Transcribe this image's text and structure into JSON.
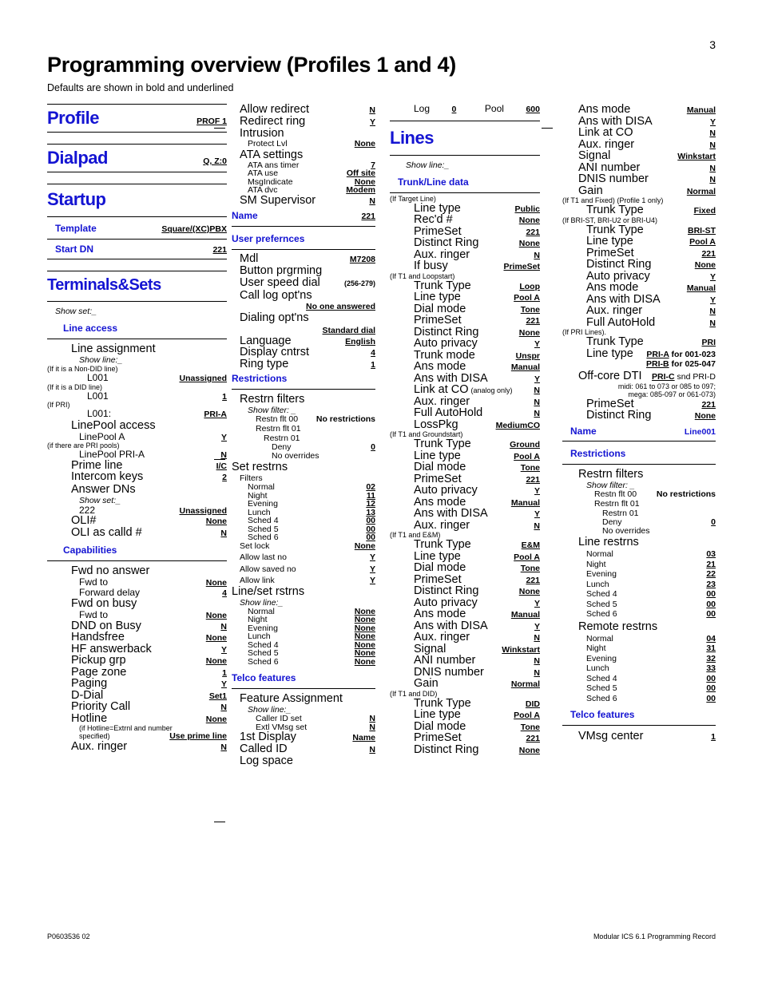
{
  "page": {
    "number": "3",
    "title": "Programming overview (Profiles 1 and 4)",
    "subtitle": "Defaults are shown in bold and underlined",
    "footer_left": "P0603536   02",
    "footer_right": "Modular ICS 6.1 Programming Record",
    "accent_color": "#1414d2"
  },
  "col1": {
    "profile": {
      "heading": "Profile",
      "value": "PROF 1"
    },
    "dialpad": {
      "heading": "Dialpad",
      "value": "Q, Z:0"
    },
    "startup": {
      "heading": "Startup",
      "rows": [
        {
          "label": "Template",
          "value": "Square/(XC)PBX"
        },
        {
          "label": "Start DN",
          "value": "221"
        }
      ]
    },
    "terminals": {
      "heading": "Terminals&Sets",
      "show_set": "Show set:_",
      "line_access": {
        "heading": "Line access",
        "line_assignment": "Line assignment",
        "show_line": "Show line:_",
        "cond_nondid": "(If it is a Non-DID line)",
        "l001_nondid": {
          "label": "L001",
          "value": "Unassigned"
        },
        "cond_did": "(If it is a DID line)",
        "l001_did": {
          "label": "L001",
          "value": "1"
        },
        "cond_pri": "(If PRI)",
        "l001_pri": {
          "label": "L001:",
          "value": "PRI-A"
        },
        "linepool_access": "LinePool access",
        "linepool_a": {
          "label": "LinePool  A",
          "value": "Y"
        },
        "cond_pripools": "(if there are PRI pools)",
        "linepool_pri_a": {
          "label": "LinePool PRI-A",
          "value": "N"
        },
        "rows": [
          {
            "label": "Prime line",
            "value": "I/C"
          },
          {
            "label": "Intercom keys",
            "value": "2"
          }
        ],
        "answer_dns": "Answer DNs",
        "show_set2": "Show set:_",
        "dn222": {
          "label": "222",
          "value": "Unassigned"
        },
        "rows2": [
          {
            "label": "OLI#",
            "value": "None"
          },
          {
            "label": "OLI as calld #",
            "value": "N"
          }
        ]
      },
      "capabilities": {
        "heading": "Capabilities",
        "fwd_no_answer": "Fwd no answer",
        "fwd_no_answer_rows": [
          {
            "label": "Fwd to",
            "value": "None"
          },
          {
            "label": "Forward delay",
            "value": "4"
          }
        ],
        "fwd_on_busy": "Fwd on busy",
        "fwd_on_busy_rows": [
          {
            "label": "Fwd to",
            "value": "None"
          }
        ],
        "rows": [
          {
            "label": "DND on Busy",
            "value": "N"
          },
          {
            "label": "Handsfree",
            "value": "None"
          },
          {
            "label": "HF answerback",
            "value": "Y"
          },
          {
            "label": "Pickup grp",
            "value": "None"
          },
          {
            "label": "Page zone",
            "value": "1"
          },
          {
            "label": "Paging",
            "value": "Y"
          },
          {
            "label": "D-Dial",
            "value": "Set1"
          },
          {
            "label": "Priority Call",
            "value": "N"
          },
          {
            "label": "Hotline",
            "value": "None"
          }
        ],
        "hotline_cond1": "(if Hotline=Extrnl and number",
        "hotline_cond2": "specified)",
        "hotline_cond_value": "Use prime line",
        "aux_ringer": {
          "label": "Aux. ringer",
          "value": "N"
        }
      }
    }
  },
  "col2": {
    "top_rows": [
      {
        "label": "Allow redirect",
        "value": "N",
        "size": "big",
        "indent": 1
      },
      {
        "label": "Redirect ring",
        "value": "Y",
        "size": "big",
        "indent": 1
      },
      {
        "label": "Intrusion",
        "value": "",
        "size": "big",
        "indent": 1
      },
      {
        "label": "Protect Lvl",
        "value": "None",
        "size": "sm",
        "indent": 2
      },
      {
        "label": "ATA settings",
        "value": "",
        "size": "big",
        "indent": 1
      },
      {
        "label": "ATA ans timer",
        "value": "7",
        "size": "sm",
        "indent": 2
      },
      {
        "label": "ATA use",
        "value": "Off site",
        "size": "sm",
        "indent": 2
      },
      {
        "label": "MsgIndicate",
        "value": "None",
        "size": "sm",
        "indent": 2
      },
      {
        "label": "ATA dvc",
        "value": "Modem",
        "size": "sm",
        "indent": 2
      },
      {
        "label": "SM Supervisor",
        "value": "N",
        "size": "big",
        "indent": 1
      }
    ],
    "name": {
      "heading": "Name",
      "value": "221"
    },
    "user_prefs": {
      "heading": "User prefernces",
      "rows": [
        {
          "label": "Mdl",
          "value": "M7208"
        },
        {
          "label": "Button prgrming",
          "value": ""
        },
        {
          "label": "User speed dial",
          "value": "(256-279)"
        },
        {
          "label": "Call log opt'ns",
          "value": ""
        }
      ],
      "call_log_value": "No one answered",
      "dialing_optns": "Dialing opt'ns",
      "dialing_value": "Standard dial",
      "rows2": [
        {
          "label": "Language",
          "value": "English"
        },
        {
          "label": "Display cntrst",
          "value": "4"
        },
        {
          "label": "Ring type",
          "value": "1"
        }
      ]
    },
    "restrictions": {
      "heading": "Restrictions",
      "restrn_filters": "Restrn filters",
      "show_filter": "Show filter: _",
      "flt00": {
        "label": "Restn flt 00",
        "value": "No restrictions"
      },
      "flt01": "Restrn flt 01",
      "restrn01": "Restrn 01",
      "deny": {
        "label": "Deny",
        "value": "0"
      },
      "no_overrides": "No overrides",
      "set_restrns": "Set restrns",
      "filters": "Filters",
      "filter_rows": [
        {
          "label": "Normal",
          "value": "02"
        },
        {
          "label": "Night",
          "value": "11"
        },
        {
          "label": "Evening",
          "value": "12"
        },
        {
          "label": "Lunch",
          "value": "13"
        },
        {
          "label": "Sched 4",
          "value": "00"
        },
        {
          "label": "Sched 5",
          "value": "00"
        },
        {
          "label": "Sched 6",
          "value": "00"
        }
      ],
      "set_lock": {
        "label": "Set lock",
        "value": "None"
      },
      "allow_rows": [
        {
          "label": "Allow last no",
          "value": "Y"
        },
        {
          "label": "Allow saved no",
          "value": "Y"
        },
        {
          "label": "Allow link",
          "value": "Y"
        }
      ],
      "line_set_rstrns": "Line/set rstrns",
      "show_line": "Show line:_",
      "line_rows": [
        {
          "label": "Normal",
          "value": "None"
        },
        {
          "label": "Night",
          "value": "None"
        },
        {
          "label": "Evening",
          "value": "None"
        },
        {
          "label": "Lunch",
          "value": "None"
        },
        {
          "label": "Sched 4",
          "value": "None"
        },
        {
          "label": "Sched 5",
          "value": "None"
        },
        {
          "label": "Sched 6",
          "value": "None"
        }
      ]
    },
    "telco": {
      "heading": "Telco features",
      "feature_assignment": "Feature Assignment",
      "show_line": "Show line:_",
      "rows_sm": [
        {
          "label": "Caller ID set",
          "value": "N"
        },
        {
          "label": "Extl VMsg set",
          "value": "N"
        }
      ],
      "rows_big": [
        {
          "label": "1st Display",
          "value": "Name"
        },
        {
          "label": "Called ID",
          "value": "N"
        },
        {
          "label": "Log space",
          "value": ""
        }
      ]
    }
  },
  "col3": {
    "log_pool": {
      "log_label": "Log",
      "log_value": "0",
      "pool_label": "Pool",
      "pool_value": "600"
    },
    "lines_heading": "Lines",
    "show_line": "Show line:_",
    "trunk_line_data": "Trunk/Line data",
    "cond_target": "(If Target Line)",
    "target_rows": [
      {
        "label": "Line type",
        "value": "Public"
      },
      {
        "label": "Rec'd #",
        "value": "None"
      },
      {
        "label": "PrimeSet",
        "value": "221"
      },
      {
        "label": "Distinct Ring",
        "value": "None"
      },
      {
        "label": "Aux. ringer",
        "value": "N"
      },
      {
        "label": "If busy",
        "value": "PrimeSet"
      }
    ],
    "cond_loopstart": "(If T1 and Loopstart)",
    "loop_rows": [
      {
        "label": "Trunk Type",
        "value": "Loop"
      },
      {
        "label": "Line type",
        "value": "Pool A"
      },
      {
        "label": "Dial mode",
        "value": "Tone"
      },
      {
        "label": "PrimeSet",
        "value": "221"
      },
      {
        "label": "Distinct Ring",
        "value": "None"
      },
      {
        "label": "Auto privacy",
        "value": "Y"
      },
      {
        "label": "Trunk mode",
        "value": "Unspr"
      },
      {
        "label": "Ans mode",
        "value": "Manual"
      },
      {
        "label": "Ans with DISA",
        "value": "Y"
      }
    ],
    "link_at_co": {
      "label": "Link at CO",
      "note": "(analog only)",
      "value": "N"
    },
    "loop_rows2": [
      {
        "label": "Aux. ringer",
        "value": "N"
      },
      {
        "label": "Full AutoHold",
        "value": "N"
      },
      {
        "label": "LossPkg",
        "value": "MediumCO"
      }
    ],
    "cond_groundstart": "(If T1 and Groundstart)",
    "ground_rows": [
      {
        "label": "Trunk Type",
        "value": "Ground"
      },
      {
        "label": "Line type",
        "value": "Pool A"
      },
      {
        "label": "Dial mode",
        "value": "Tone"
      },
      {
        "label": "PrimeSet",
        "value": "221"
      },
      {
        "label": "Auto privacy",
        "value": "Y"
      },
      {
        "label": "Ans mode",
        "value": "Manual"
      },
      {
        "label": "Ans with DISA",
        "value": "Y"
      },
      {
        "label": "Aux. ringer",
        "value": "N"
      }
    ],
    "cond_em": "(If T1 and E&M)",
    "em_rows": [
      {
        "label": "Trunk Type",
        "value": "E&M"
      },
      {
        "label": "Line type",
        "value": "Pool A"
      },
      {
        "label": "Dial mode",
        "value": "Tone"
      },
      {
        "label": "PrimeSet",
        "value": "221"
      },
      {
        "label": "Distinct Ring",
        "value": "None"
      },
      {
        "label": "Auto privacy",
        "value": "Y"
      },
      {
        "label": "Ans mode",
        "value": "Manual"
      },
      {
        "label": "Ans with DISA",
        "value": "Y"
      },
      {
        "label": "Aux. ringer",
        "value": "N"
      },
      {
        "label": "Signal",
        "value": "Winkstart"
      },
      {
        "label": "ANI number",
        "value": "N"
      },
      {
        "label": "DNIS number",
        "value": "N"
      },
      {
        "label": "Gain",
        "value": "Normal"
      }
    ],
    "cond_did": "(If T1 and DID)",
    "did_rows": [
      {
        "label": "Trunk Type",
        "value": "DID"
      },
      {
        "label": "Line type",
        "value": "Pool A"
      },
      {
        "label": "Dial mode",
        "value": "Tone"
      },
      {
        "label": "PrimeSet",
        "value": "221"
      },
      {
        "label": "Distinct Ring",
        "value": "None"
      }
    ]
  },
  "col4": {
    "top_rows": [
      {
        "label": "Ans mode",
        "value": "Manual"
      },
      {
        "label": "Ans with DISA",
        "value": "Y"
      },
      {
        "label": "Link at CO",
        "value": "N"
      },
      {
        "label": "Aux. ringer",
        "value": "N"
      },
      {
        "label": "Signal",
        "value": "Winkstart"
      },
      {
        "label": "ANI number",
        "value": "N"
      },
      {
        "label": "DNIS number",
        "value": "N"
      },
      {
        "label": "Gain",
        "value": "Normal"
      }
    ],
    "cond_fixed": "(If T1 and Fixed) (Profile 1 only)",
    "fixed_row": {
      "label": "Trunk Type",
      "value": "Fixed"
    },
    "cond_bri": "(If BRI-ST, BRI-U2 or BRI-U4)",
    "bri_rows": [
      {
        "label": "Trunk Type",
        "value": "BRI-ST"
      },
      {
        "label": "Line type",
        "value": "Pool A"
      },
      {
        "label": "PrimeSet",
        "value": "221"
      },
      {
        "label": "Distinct Ring",
        "value": "None"
      },
      {
        "label": "Auto privacy",
        "value": "Y"
      },
      {
        "label": "Ans mode",
        "value": "Manual"
      },
      {
        "label": "Ans with DISA",
        "value": "Y"
      },
      {
        "label": "Aux. ringer",
        "value": "N"
      },
      {
        "label": "Full AutoHold",
        "value": "N"
      }
    ],
    "cond_pri": "(If PRI Lines).",
    "pri_trunk": {
      "label": "Trunk Type",
      "value": "PRI"
    },
    "pri_linetype_label": "Line type",
    "pri_linetype_v1_bold": "PRI-A",
    "pri_linetype_v1_rest": " for 001-023",
    "pri_linetype_v2_bold": "PRI-B",
    "pri_linetype_v2_rest": " for 025-047",
    "offcore_label": "Off-core DTI",
    "offcore_bold": "PRI-C",
    "offcore_rest": " snd PRI-D",
    "offcore_note1": "midi: 061 to 073 or 085 to 097;",
    "offcore_note2": "mega: 085-097 or 061-073)",
    "pri_rows2": [
      {
        "label": "PrimeSet",
        "value": "221"
      },
      {
        "label": "Distinct Ring",
        "value": "None"
      }
    ],
    "name": {
      "heading": "Name",
      "value": "Line001"
    },
    "restrictions": {
      "heading": "Restrictions",
      "restrn_filters": "Restrn filters",
      "show_filter": "Show filter: _",
      "flt00": {
        "label": "Restn flt 00",
        "value": "No restrictions"
      },
      "flt01": "Restrn flt 01",
      "restrn01": "Restrn 01",
      "deny": {
        "label": "Deny",
        "value": "0"
      },
      "no_overrides": "No overrides",
      "line_restrns": "Line restrns",
      "line_rows": [
        {
          "label": "Normal",
          "value": "03"
        },
        {
          "label": "Night",
          "value": "21"
        },
        {
          "label": "Evening",
          "value": "22"
        },
        {
          "label": "Lunch",
          "value": "23"
        },
        {
          "label": "Sched 4",
          "value": "00"
        },
        {
          "label": "Sched 5",
          "value": "00"
        },
        {
          "label": "Sched 6",
          "value": "00"
        }
      ],
      "remote_restrns": "Remote restrns",
      "remote_rows": [
        {
          "label": "Normal",
          "value": "04"
        },
        {
          "label": "Night",
          "value": "31"
        },
        {
          "label": "Evening",
          "value": "32"
        },
        {
          "label": "Lunch",
          "value": "33"
        },
        {
          "label": "Sched 4",
          "value": "00"
        },
        {
          "label": "Sched 5",
          "value": "00"
        },
        {
          "label": "Sched 6",
          "value": "00"
        }
      ]
    },
    "telco": {
      "heading": "Telco features",
      "vmsg": {
        "label": "VMsg center",
        "value": "1"
      }
    }
  }
}
